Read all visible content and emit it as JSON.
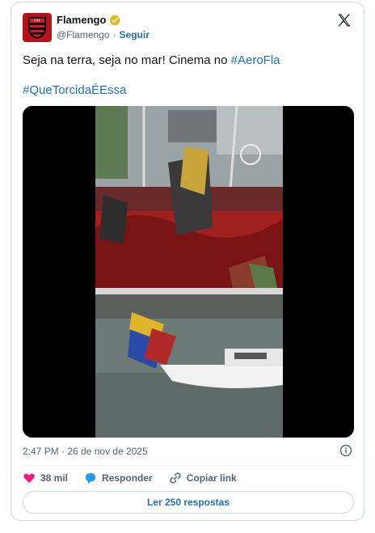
{
  "author": {
    "name": "Flamengo",
    "handle": "@Flamengo",
    "separator": "·",
    "follow_label": "Seguir"
  },
  "tweet": {
    "text_before": "Seja na terra, seja no mar! Cinema no ",
    "hashtag1": "#AeroFla",
    "hashtag2": "#QueTorcidaÉEssa"
  },
  "timestamp": "2:47 PM · 26 de nov de 2025",
  "actions": {
    "likes": "38 mil",
    "reply_label": "Responder",
    "copy_label": "Copiar link"
  },
  "replies_button": "Ler 250 respostas",
  "icons": {
    "avatar": "flamengo-crest-icon",
    "verified": "verified-badge-icon",
    "x": "x-logo-icon",
    "info": "info-icon",
    "heart": "heart-icon",
    "reply": "reply-bubble-icon",
    "link": "link-icon"
  },
  "colors": {
    "accent": "#1d6fb8",
    "heart": "#f91880",
    "verified": "#e2b719",
    "brand": "#b5121b"
  }
}
